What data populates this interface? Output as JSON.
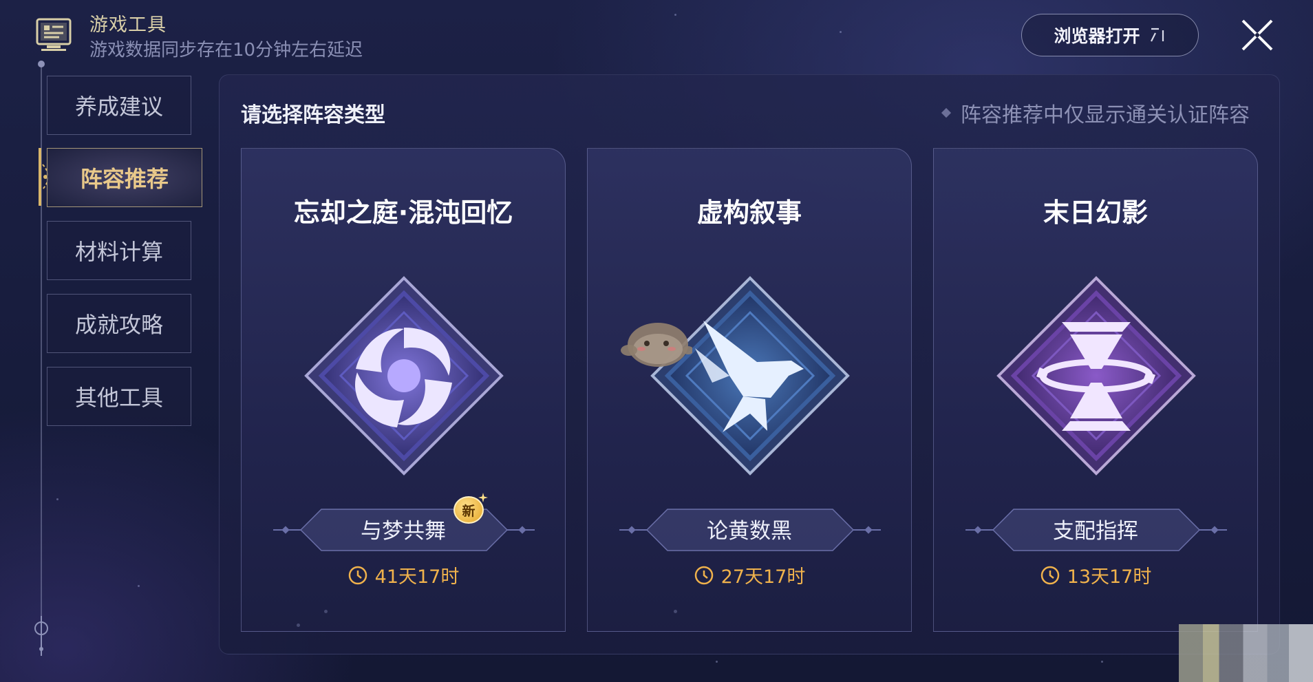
{
  "header": {
    "title": "游戏工具",
    "subtitle": "游戏数据同步存在10分钟左右延迟",
    "browser_button": "浏览器打开"
  },
  "sidebar": {
    "items": [
      {
        "label": "养成建议",
        "active": false
      },
      {
        "label": "阵容推荐",
        "active": true
      },
      {
        "label": "材料计算",
        "active": false
      },
      {
        "label": "成就攻略",
        "active": false
      },
      {
        "label": "其他工具",
        "active": false
      }
    ]
  },
  "main": {
    "title": "请选择阵容类型",
    "note": "阵容推荐中仅显示通关认证阵容",
    "cards": [
      {
        "title": "忘却之庭·混沌回忆",
        "tag": "与梦共舞",
        "new_badge": "新",
        "timer": "41天17时",
        "icon": "spiral-vortex-icon"
      },
      {
        "title": "虚构叙事",
        "tag": "论黄数黑",
        "timer": "27天17时",
        "icon": "bird-icon"
      },
      {
        "title": "末日幻影",
        "tag": "支配指挥",
        "timer": "13天17时",
        "icon": "hourglass-icon"
      }
    ]
  },
  "colors": {
    "accent_gold": "#e9c98a",
    "timer_orange": "#f0b24c",
    "card_border": "#8c91c3",
    "background": "#1a1f42"
  }
}
